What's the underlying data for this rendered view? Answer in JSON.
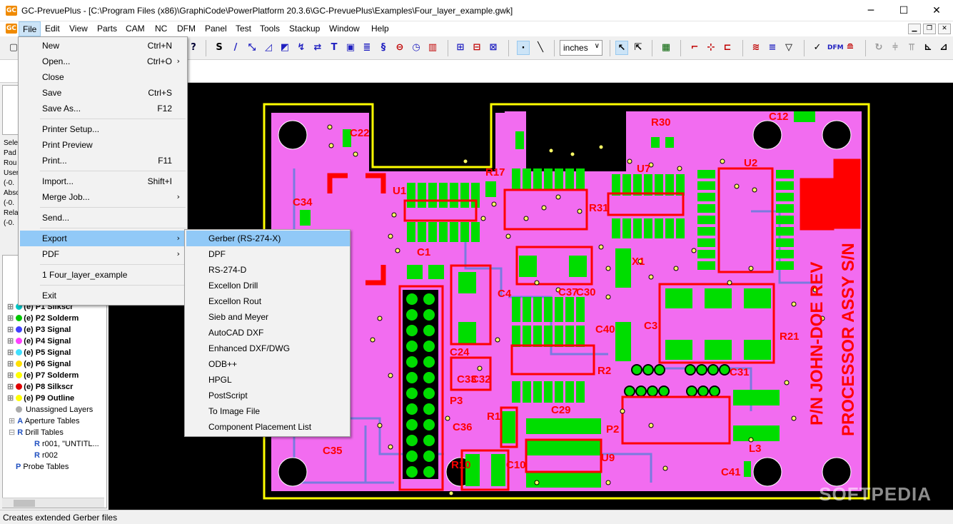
{
  "window": {
    "title": "GC-PrevuePlus - [C:\\Program Files (x86)\\GraphiCode\\PowerPlatform 20.3.6\\GC-PrevuePlus\\Examples\\Four_layer_example.gwk]",
    "app_icon_text": "GC",
    "minimize": "─",
    "maximize": "☐",
    "close": "✕"
  },
  "menubar": {
    "items": [
      "File",
      "Edit",
      "View",
      "Parts",
      "CAM",
      "NC",
      "DFM",
      "Panel",
      "Test",
      "Tools",
      "Stackup",
      "Window",
      "Help"
    ],
    "mdi_min": "▁",
    "mdi_restore": "❐",
    "mdi_close": "✕"
  },
  "toolbar": {
    "units_value": "inches",
    "units_arrow": "∨"
  },
  "file_menu": {
    "items": [
      {
        "label": "New",
        "shortcut": "Ctrl+N"
      },
      {
        "label": "Open...",
        "shortcut": "Ctrl+O"
      },
      {
        "label": "Close",
        "shortcut": ""
      },
      {
        "label": "Save",
        "shortcut": "Ctrl+S"
      },
      {
        "label": "Save As...",
        "shortcut": "F12"
      },
      {
        "label": "Printer Setup...",
        "shortcut": ""
      },
      {
        "label": "Print Preview",
        "shortcut": ""
      },
      {
        "label": "Print...",
        "shortcut": "F11"
      },
      {
        "label": "Import...",
        "shortcut": "Shift+I"
      },
      {
        "label": "Merge Job...",
        "shortcut": ""
      },
      {
        "label": "Send...",
        "shortcut": ""
      },
      {
        "label": "Export",
        "shortcut": ""
      },
      {
        "label": "PDF",
        "shortcut": ""
      },
      {
        "label": "1 Four_layer_example",
        "shortcut": ""
      },
      {
        "label": "Exit",
        "shortcut": ""
      }
    ],
    "submenu_arrow": "›"
  },
  "export_menu": {
    "items": [
      "Gerber (RS-274-X)",
      "DPF",
      "RS-274-D",
      "Excellon Drill",
      "Excellon Rout",
      "Sieb and Meyer",
      "AutoCAD DXF",
      "Enhanced DXF/DWG",
      "ODB++",
      "HPGL",
      "PostScript",
      "To Image File",
      "Component Placement List"
    ]
  },
  "left_panel": {
    "info_lines": [
      "Sele",
      "Pad",
      "Rou",
      "",
      "User",
      "(-0.",
      "Abso",
      "(-0.",
      "Rela",
      "(-0."
    ]
  },
  "layer_tree": {
    "layers": [
      {
        "label": "(e) P1 Silkscr",
        "color": "#00c8c8"
      },
      {
        "label": "(e) P2 Solderm",
        "color": "#00c800"
      },
      {
        "label": "(e) P3 Signal",
        "color": "#4040ff"
      },
      {
        "label": "(e) P4 Signal",
        "color": "#ff40ff"
      },
      {
        "label": "(e) P5 Signal",
        "color": "#40e0ff"
      },
      {
        "label": "(e) P6 Signal",
        "color": "#ffe000"
      },
      {
        "label": "(e) P7 Solderm",
        "color": "#ffff00"
      },
      {
        "label": "(e) P8 Silkscr",
        "color": "#e00000"
      },
      {
        "label": "(e) P9 Outline",
        "color": "#ffff00"
      }
    ],
    "nodes": [
      "Unassigned Layers",
      "Aperture Tables",
      "Drill Tables",
      "r001, \"UNTITL...",
      "r002",
      "Probe Tables"
    ]
  },
  "board": {
    "silk_labels": [
      "U1",
      "C22",
      "C34",
      "R17",
      "U7",
      "U2",
      "R30",
      "C12",
      "C1",
      "C4",
      "R31",
      "X1",
      "C3",
      "R21",
      "C24",
      "P3",
      "R1",
      "C36",
      "C29",
      "P2",
      "U9",
      "C41",
      "L3",
      "R2",
      "C31",
      "R10",
      "C10",
      "C40",
      "C37",
      "C30",
      "C33",
      "C32",
      "C35"
    ],
    "vertical_text_1": "P/N JOHN-DOE REV",
    "vertical_text_2": "PROCESSOR ASSY S/N",
    "watermark": "SOFTPEDIA"
  },
  "colors": {
    "board_fill": "#f26cf0",
    "outline": "#ffff00",
    "silkscreen": "#ff0000",
    "pad": "#00dd00",
    "trace": "#7a7adf",
    "menu_highlight": "#91c9f7"
  },
  "status_bar": {
    "text": "Creates extended Gerber files"
  }
}
